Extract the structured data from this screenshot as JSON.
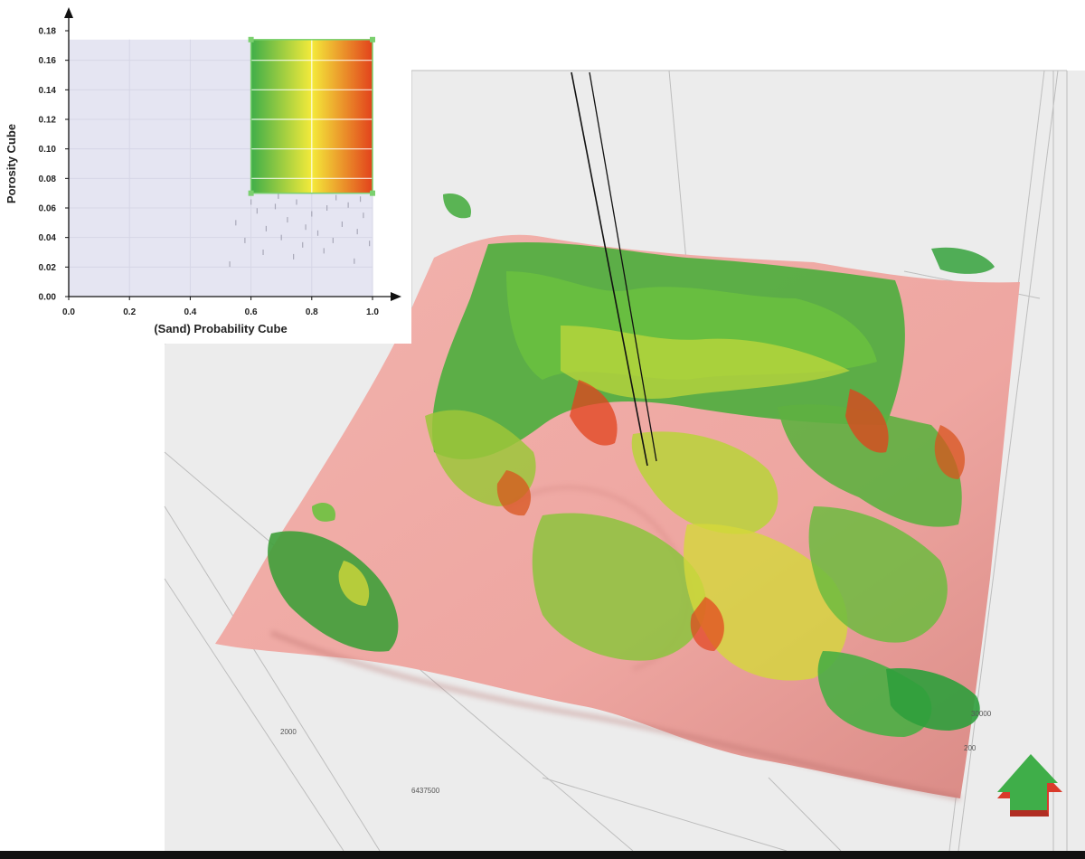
{
  "viewport": {
    "coordinate_labels": [
      "2000",
      "6437500",
      "30000",
      "200"
    ],
    "colors": {
      "surface": "#eea6a1",
      "surface_dark": "#cf807c",
      "background": "#ececec",
      "grid": "#bdbdbd",
      "well": "#111111"
    }
  },
  "orientation_arrow": {
    "icon": "up-arrow-icon",
    "colors": {
      "face": "#3fae49",
      "side": "#d93a2b"
    }
  },
  "chart_data": {
    "type": "scatter",
    "title": "",
    "xlabel": "(Sand) Probability Cube",
    "ylabel": "Porosity Cube",
    "xlim": [
      0,
      1.0
    ],
    "ylim": [
      0,
      0.18
    ],
    "x_ticks": [
      "0.0",
      "0.2",
      "0.4",
      "0.6",
      "0.8",
      "1.0"
    ],
    "y_ticks": [
      "0.00",
      "0.02",
      "0.04",
      "0.06",
      "0.08",
      "0.10",
      "0.12",
      "0.14",
      "0.16",
      "0.18"
    ],
    "plot_max": {
      "x": 1.0,
      "y": 0.174
    },
    "grid": true,
    "selection_box": {
      "x": [
        0.6,
        1.0
      ],
      "y": [
        0.07,
        0.174
      ]
    },
    "colorbar_stops": [
      "#3fae49",
      "#f4ea3a",
      "#e2421c"
    ],
    "points": [
      {
        "x": 0.62,
        "y": 0.058
      },
      {
        "x": 0.65,
        "y": 0.046
      },
      {
        "x": 0.68,
        "y": 0.061
      },
      {
        "x": 0.7,
        "y": 0.04
      },
      {
        "x": 0.72,
        "y": 0.052
      },
      {
        "x": 0.75,
        "y": 0.064
      },
      {
        "x": 0.77,
        "y": 0.035
      },
      {
        "x": 0.8,
        "y": 0.056
      },
      {
        "x": 0.82,
        "y": 0.043
      },
      {
        "x": 0.85,
        "y": 0.06
      },
      {
        "x": 0.87,
        "y": 0.038
      },
      {
        "x": 0.9,
        "y": 0.049
      },
      {
        "x": 0.92,
        "y": 0.062
      },
      {
        "x": 0.95,
        "y": 0.044
      },
      {
        "x": 0.97,
        "y": 0.055
      },
      {
        "x": 0.99,
        "y": 0.036
      },
      {
        "x": 0.64,
        "y": 0.03
      },
      {
        "x": 0.74,
        "y": 0.027
      },
      {
        "x": 0.84,
        "y": 0.031
      },
      {
        "x": 0.94,
        "y": 0.024
      },
      {
        "x": 0.55,
        "y": 0.05
      },
      {
        "x": 0.58,
        "y": 0.038
      },
      {
        "x": 0.53,
        "y": 0.022
      },
      {
        "x": 0.96,
        "y": 0.066
      },
      {
        "x": 0.88,
        "y": 0.067
      },
      {
        "x": 0.78,
        "y": 0.047
      },
      {
        "x": 0.69,
        "y": 0.068
      },
      {
        "x": 0.6,
        "y": 0.064
      }
    ]
  }
}
